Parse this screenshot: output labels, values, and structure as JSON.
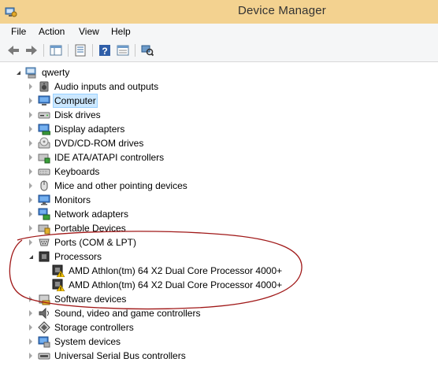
{
  "window": {
    "title": "Device Manager"
  },
  "menu": {
    "items": [
      "File",
      "Action",
      "View",
      "Help"
    ]
  },
  "toolbar": {
    "buttons": [
      "back-icon",
      "forward-icon",
      "show-hide-tree-icon",
      "properties-icon",
      "help-icon",
      "view-icon",
      "scan-hardware-icon"
    ]
  },
  "tree": {
    "root": "qwerty",
    "categories": [
      {
        "label": "Audio inputs and outputs",
        "icon": "speaker-icon"
      },
      {
        "label": "Computer",
        "icon": "computer-icon"
      },
      {
        "label": "Disk drives",
        "icon": "disk-drive-icon"
      },
      {
        "label": "Display adapters",
        "icon": "display-adapter-icon"
      },
      {
        "label": "DVD/CD-ROM drives",
        "icon": "dvd-drive-icon"
      },
      {
        "label": "IDE ATA/ATAPI controllers",
        "icon": "ide-controller-icon"
      },
      {
        "label": "Keyboards",
        "icon": "keyboard-icon"
      },
      {
        "label": "Mice and other pointing devices",
        "icon": "mouse-icon"
      },
      {
        "label": "Monitors",
        "icon": "monitor-icon"
      },
      {
        "label": "Network adapters",
        "icon": "network-adapter-icon"
      },
      {
        "label": "Portable Devices",
        "icon": "portable-device-icon"
      },
      {
        "label": "Ports (COM & LPT)",
        "icon": "port-icon"
      },
      {
        "label": "Processors",
        "icon": "processor-icon"
      },
      {
        "label": "AMD Athlon(tm) 64 X2 Dual Core Processor 4000+",
        "icon": "processor-warning-icon"
      },
      {
        "label": "AMD Athlon(tm) 64 X2 Dual Core Processor 4000+",
        "icon": "processor-warning-icon"
      },
      {
        "label": "Software devices",
        "icon": "software-device-icon"
      },
      {
        "label": "Sound, video and game controllers",
        "icon": "sound-controller-icon"
      },
      {
        "label": "Storage controllers",
        "icon": "storage-controller-icon"
      },
      {
        "label": "System devices",
        "icon": "system-device-icon"
      },
      {
        "label": "Universal Serial Bus controllers",
        "icon": "usb-controller-icon"
      }
    ]
  },
  "colors": {
    "titlebar": "#f3d290",
    "selection": "#cce8ff",
    "annotation": "#a01818",
    "warning": "#f7c600"
  }
}
